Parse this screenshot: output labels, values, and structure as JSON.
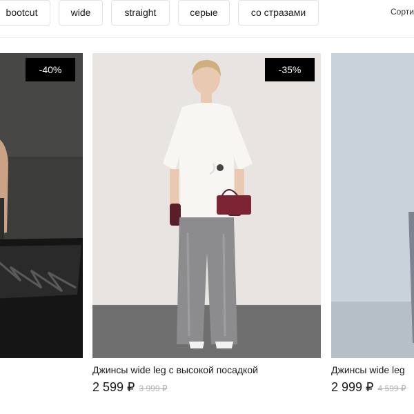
{
  "filters": {
    "chips": [
      "bootcut",
      "wide",
      "straight",
      "серые",
      "со стразами"
    ],
    "sort_label": "Сорти"
  },
  "products": [
    {
      "discount": "-40%",
      "title": "",
      "price": "",
      "old_price": ""
    },
    {
      "discount": "-35%",
      "title": "Джинсы wide leg с высокой посадкой",
      "price": "2 599 ₽",
      "old_price": "3 999 ₽"
    },
    {
      "discount": "",
      "title": "Джинсы wide leg",
      "price": "2 999 ₽",
      "old_price": "4 599 ₽"
    }
  ]
}
